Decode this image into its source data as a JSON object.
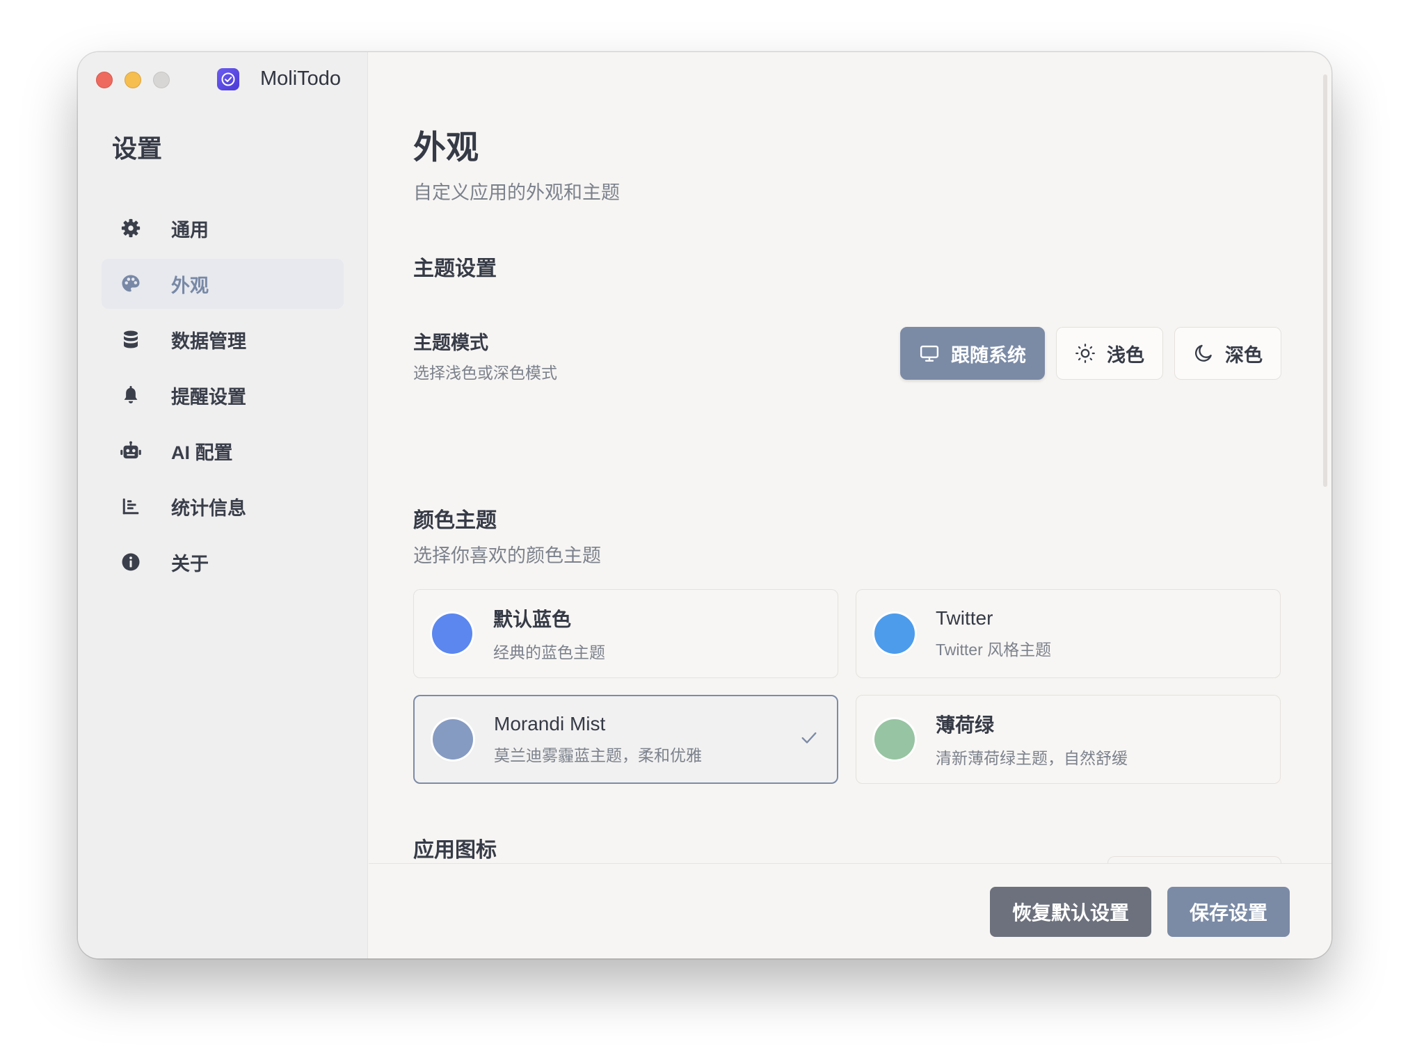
{
  "app": {
    "name": "MoliTodo"
  },
  "sidebar": {
    "title": "设置",
    "items": [
      {
        "label": "通用",
        "icon": "gear-icon",
        "active": false
      },
      {
        "label": "外观",
        "icon": "palette-icon",
        "active": true
      },
      {
        "label": "数据管理",
        "icon": "database-icon",
        "active": false
      },
      {
        "label": "提醒设置",
        "icon": "bell-icon",
        "active": false
      },
      {
        "label": "AI 配置",
        "icon": "robot-icon",
        "active": false
      },
      {
        "label": "统计信息",
        "icon": "chart-icon",
        "active": false
      },
      {
        "label": "关于",
        "icon": "info-icon",
        "active": false
      }
    ]
  },
  "page": {
    "title": "外观",
    "subtitle": "自定义应用的外观和主题"
  },
  "theme_settings": {
    "title": "主题设置",
    "mode_label": "主题模式",
    "mode_desc": "选择浅色或深色模式",
    "modes": [
      {
        "label": "跟随系统",
        "icon": "monitor-icon",
        "selected": true
      },
      {
        "label": "浅色",
        "icon": "sun-icon",
        "selected": false
      },
      {
        "label": "深色",
        "icon": "moon-icon",
        "selected": false
      }
    ]
  },
  "color_theme": {
    "title": "颜色主题",
    "desc": "选择你喜欢的颜色主题",
    "themes": [
      {
        "name": "默认蓝色",
        "desc": "经典的蓝色主题",
        "color": "#5b87ef",
        "selected": false
      },
      {
        "name": "Twitter",
        "desc": "Twitter 风格主题",
        "color": "#4d9cec",
        "selected": false
      },
      {
        "name": "Morandi Mist",
        "desc": "莫兰迪雾霾蓝主题，柔和优雅",
        "color": "#869bc2",
        "selected": true
      },
      {
        "name": "薄荷绿",
        "desc": "清新薄荷绿主题，自然舒缓",
        "color": "#97c4a2",
        "selected": false
      }
    ]
  },
  "app_icon": {
    "title": "应用图标"
  },
  "footer": {
    "reset_label": "恢复默认设置",
    "save_label": "保存设置"
  },
  "colors": {
    "accent": "#7b8ba6",
    "reset_button": "#6c717d",
    "window_bg": "#f7f5f3",
    "sidebar_bg": "#f0efef"
  }
}
